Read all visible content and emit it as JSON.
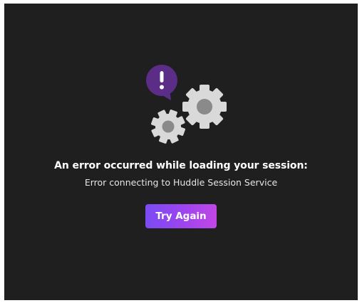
{
  "error": {
    "title": "An error occurred while loading your session:",
    "detail": "Error connecting to Huddle Session Service",
    "illustration_icons": [
      "exclamation-bubble-icon",
      "large-gear-icon",
      "small-gear-icon"
    ]
  },
  "actions": {
    "retry_label": "Try Again"
  },
  "colors": {
    "panel_background": "#1f1f1f",
    "bubble": "#5b2d86",
    "gear": "#d9d9d9",
    "gear_hub": "#8a8a8a",
    "button_gradient_start": "#7b4bf2",
    "button_gradient_end": "#c246e6",
    "text": "#ffffff"
  }
}
